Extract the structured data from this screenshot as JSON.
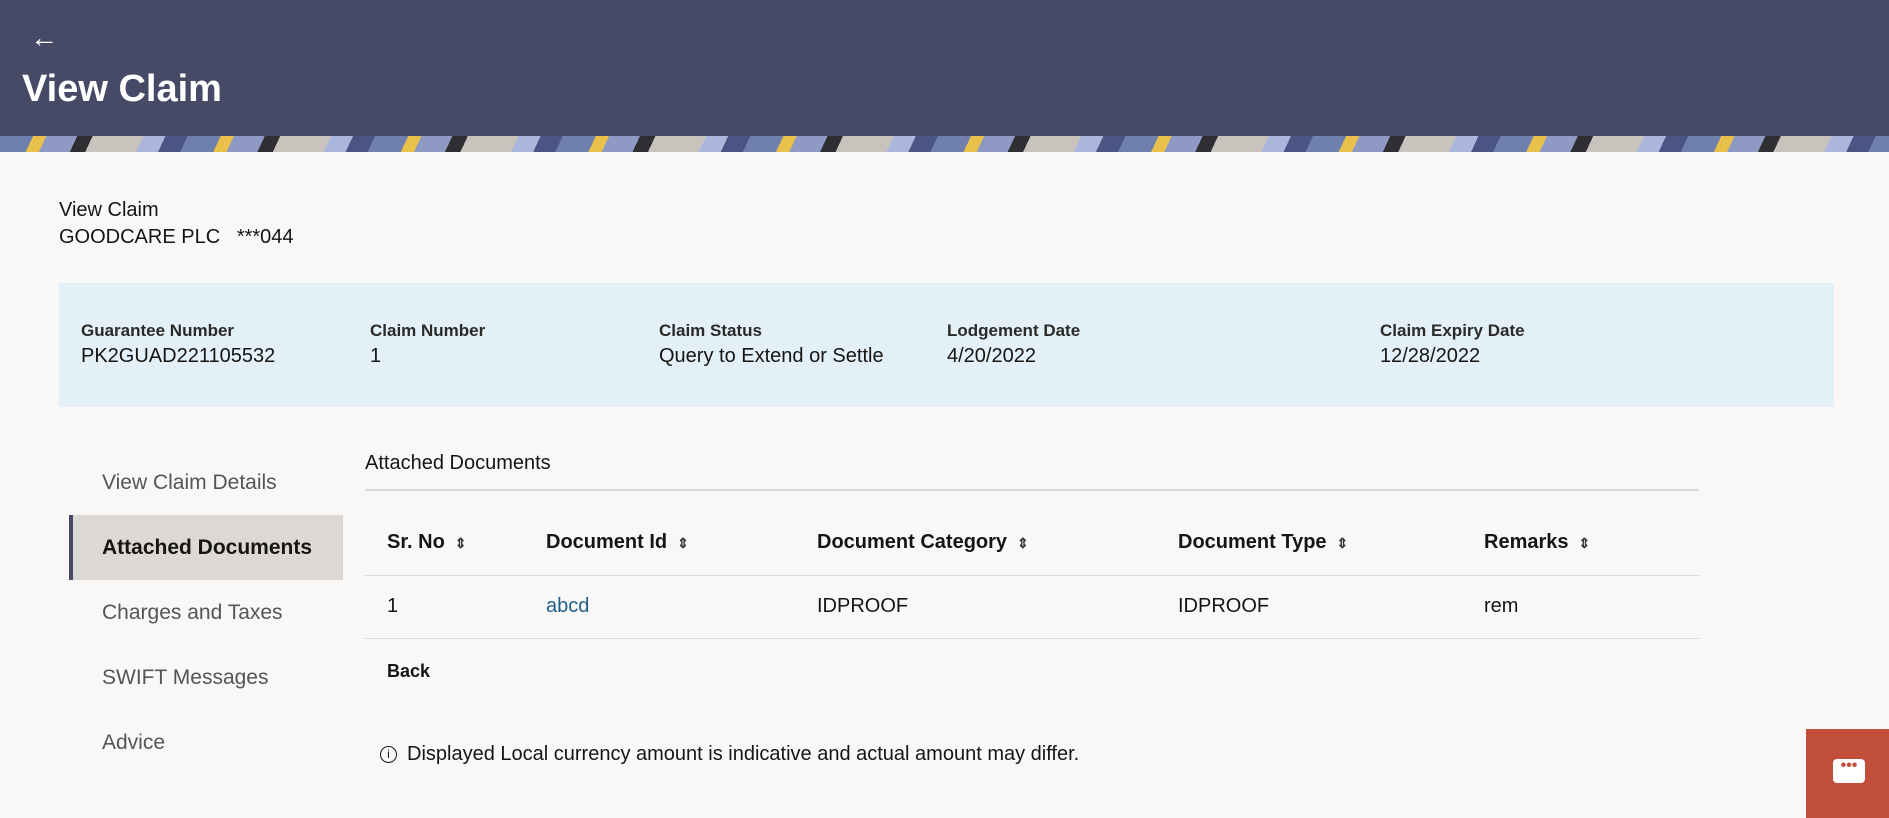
{
  "header": {
    "title": "View Claim"
  },
  "subheader": {
    "title": "View Claim",
    "party": "GOODCARE PLC",
    "account": "***044"
  },
  "summary": [
    {
      "label": "Guarantee Number",
      "value": "PK2GUAD221105532"
    },
    {
      "label": "Claim Number",
      "value": "1"
    },
    {
      "label": "Claim Status",
      "value": "Query to Extend or Settle"
    },
    {
      "label": "Lodgement Date",
      "value": "4/20/2022"
    },
    {
      "label": "Claim Expiry Date",
      "value": "12/28/2022"
    }
  ],
  "nav": [
    "View Claim Details",
    "Attached Documents",
    "Charges and Taxes",
    "SWIFT Messages",
    "Advice"
  ],
  "section_title": "Attached Documents",
  "table": {
    "headers": [
      "Sr. No",
      "Document Id",
      "Document Category",
      "Document Type",
      "Remarks"
    ],
    "rows": [
      [
        "1",
        "abcd",
        "IDPROOF",
        "IDPROOF",
        "rem"
      ]
    ]
  },
  "back_label": "Back",
  "note": "Displayed Local currency amount is indicative and actual amount may differ."
}
